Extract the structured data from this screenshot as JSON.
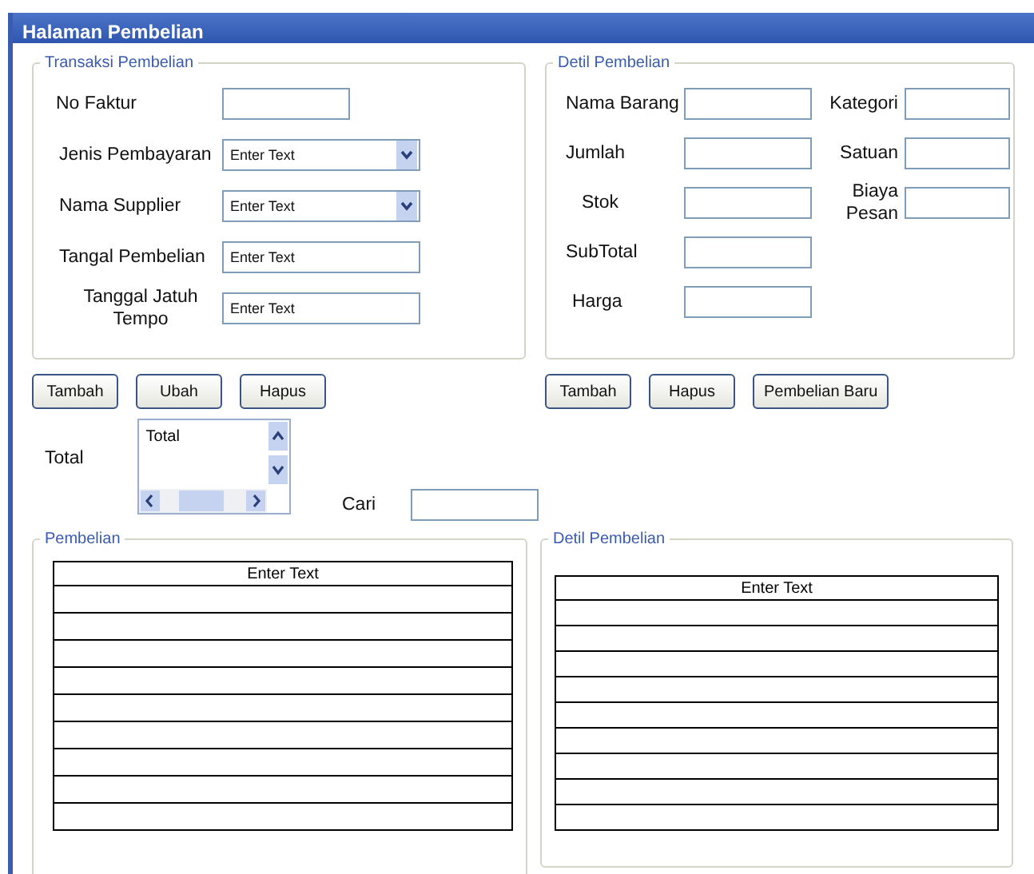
{
  "window": {
    "title": "Halaman Pembelian"
  },
  "transaksi": {
    "title": "Transaksi Pembelian",
    "fields": [
      {
        "label": "No Faktur",
        "kind": "text"
      },
      {
        "label": "Jenis Pembayaran",
        "kind": "combo",
        "placeholder": "Enter Text"
      },
      {
        "label": "Nama Supplier",
        "kind": "combo",
        "placeholder": "Enter Text"
      },
      {
        "label": "Tangal Pembelian",
        "kind": "text",
        "placeholder": "Enter Text"
      },
      {
        "label": "Tanggal Jatuh Tempo",
        "kind": "text",
        "placeholder": "Enter Text"
      }
    ]
  },
  "detil": {
    "title": "Detil Pembelian",
    "fields": [
      {
        "label": "Nama Barang"
      },
      {
        "label": "Jumlah"
      },
      {
        "label": "Stok"
      },
      {
        "label": "SubTotal"
      },
      {
        "label": "Harga"
      }
    ],
    "side_fields": [
      {
        "label": "Kategori"
      },
      {
        "label": "Satuan"
      },
      {
        "label": "Biaya Pesan"
      }
    ]
  },
  "left_buttons": [
    "Tambah",
    "Ubah",
    "Hapus"
  ],
  "right_buttons": [
    "Tambah",
    "Hapus",
    "Pembelian Baru"
  ],
  "total": {
    "label": "Total",
    "items": [
      "Total"
    ]
  },
  "search": {
    "label": "Cari"
  },
  "tables": [
    {
      "title": "Pembelian",
      "header": "Enter Text"
    },
    {
      "title": "Detil Pembelian",
      "header": "Enter Text"
    }
  ]
}
